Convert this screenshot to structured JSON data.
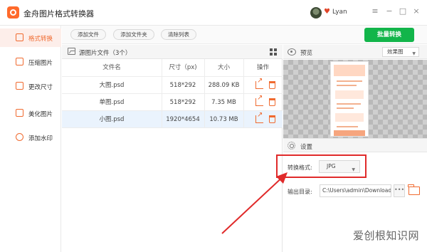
{
  "app": {
    "title": "金舟图片格式转换器",
    "user": "Lyan",
    "window_controls": [
      "≡",
      "−",
      "□",
      "×"
    ]
  },
  "sidebar": {
    "items": [
      {
        "label": "格式转换",
        "icon": "convert-icon",
        "active": true
      },
      {
        "label": "压缩图片",
        "icon": "compress-icon",
        "active": false
      },
      {
        "label": "更改尺寸",
        "icon": "resize-icon",
        "active": false
      },
      {
        "label": "美化图片",
        "icon": "beautify-icon",
        "active": false
      },
      {
        "label": "添加水印",
        "icon": "watermark-icon",
        "active": false
      }
    ]
  },
  "toolbar": {
    "add_file": "添加文件",
    "add_folder": "添加文件夹",
    "clear_list": "清除列表",
    "batch_convert": "批量转换"
  },
  "file_list": {
    "header": "源图片文件（3个）",
    "columns": [
      "文件名",
      "尺寸（px)",
      "大小",
      "操作"
    ],
    "rows": [
      {
        "name": "大图.psd",
        "size_px": "518*292",
        "size": "288.09 KB"
      },
      {
        "name": "单图.psd",
        "size_px": "518*292",
        "size": "7.35 MB"
      },
      {
        "name": "小图.psd",
        "size_px": "1920*4654",
        "size": "10.73 MB"
      }
    ]
  },
  "preview": {
    "label": "预览",
    "mode": "效果图"
  },
  "settings": {
    "label": "设置",
    "format_label": "转换格式:",
    "format_value": "JPG",
    "output_label": "输出目录:",
    "output_path": "C:\\Users\\admin\\Downloads",
    "more": "•••"
  },
  "annotation": {
    "color": "#e02a2a"
  },
  "watermark": "爱创根知识网",
  "colors": {
    "accent": "#f06a2f",
    "primary": "#12b54a"
  }
}
